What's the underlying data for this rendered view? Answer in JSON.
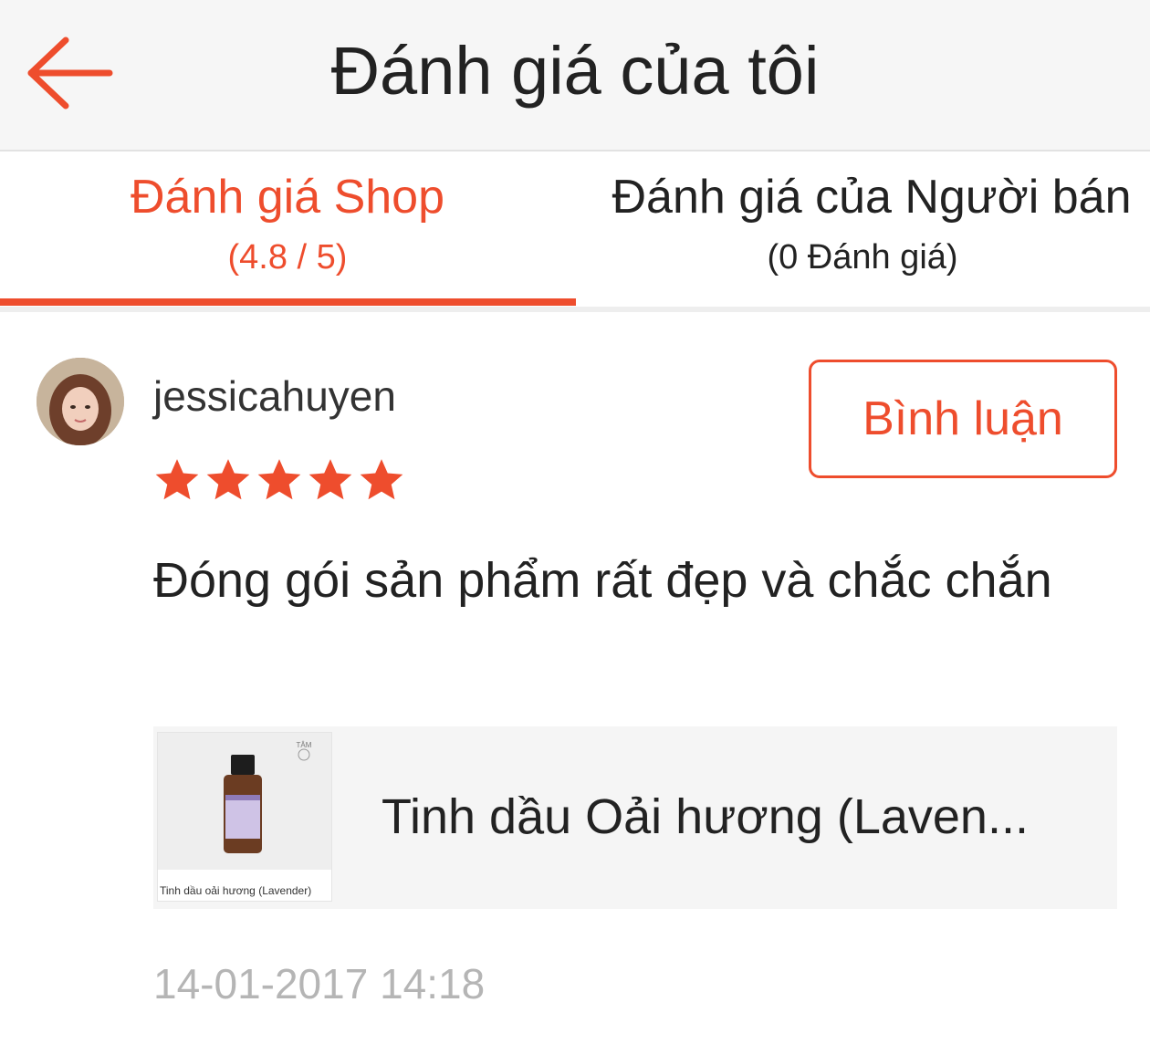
{
  "header": {
    "title": "Đánh giá của tôi",
    "back_icon": "arrow-left-icon"
  },
  "colors": {
    "accent": "#ee4d2d",
    "text": "#222222",
    "muted": "#b5b5b5"
  },
  "tabs": [
    {
      "label": "Đánh giá Shop",
      "sub": "(4.8 / 5)",
      "active": true
    },
    {
      "label": "Đánh giá của Người bán",
      "sub": "(0 Đánh giá)",
      "active": false
    }
  ],
  "review": {
    "username": "jessicahuyen",
    "rating": 5,
    "rating_max": 5,
    "comment_button": "Bình luận",
    "text": "Đóng gói sản phẩm rất đẹp và chắc chắn",
    "product": {
      "name": "Tinh dầu Oải hương (Laven...",
      "thumb_caption": "Tinh dầu oải hương (Lavender)"
    },
    "timestamp": "14-01-2017 14:18"
  }
}
